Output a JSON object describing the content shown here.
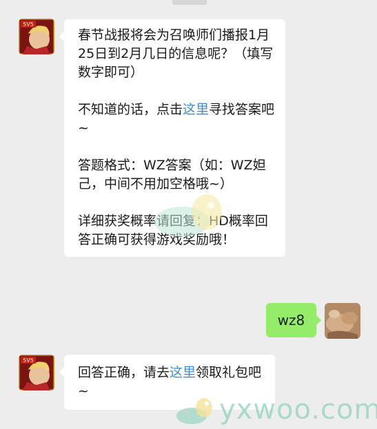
{
  "colors": {
    "background": "#ededed",
    "incoming_bubble": "#ffffff",
    "outgoing_bubble": "#95ec69",
    "link": "#3c8fd6"
  },
  "messages": [
    {
      "sender": "game-account",
      "paragraphs": [
        {
          "text": "春节战报将会为召唤师们播报1月25日到2月几日的信息呢？（填写数字即可）"
        },
        {
          "pre": "不知道的话，点击",
          "link": "这里",
          "post": "寻找答案吧~"
        },
        {
          "text": "答题格式：WZ答案（如：WZ妲己，中间不用加空格哦~）"
        },
        {
          "text": "详细获奖概率请回复：HD概率回答正确可获得游戏奖励哦！"
        }
      ]
    },
    {
      "sender": "user",
      "text": "wz8"
    },
    {
      "sender": "game-account",
      "paragraphs": [
        {
          "pre": "回答正确，请去",
          "link": "这里",
          "post": "领取礼包吧~"
        }
      ]
    }
  ],
  "avatar_badge": "5V5",
  "watermark": {
    "text": "yxwoo.com"
  }
}
